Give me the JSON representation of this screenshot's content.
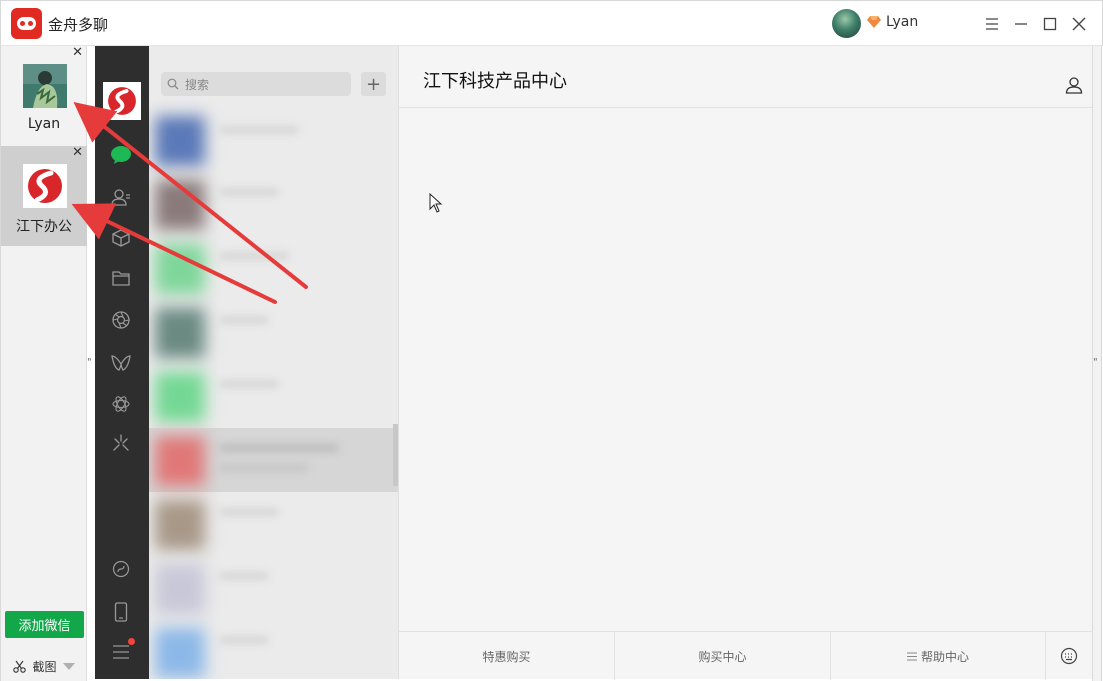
{
  "titlebar": {
    "app_title": "金舟多聊",
    "user_name": "Lyan"
  },
  "accounts": [
    {
      "label": "Lyan",
      "active": false
    },
    {
      "label": "江下办公",
      "active": true
    }
  ],
  "rail": {
    "add_wechat": "添加微信",
    "screenshot": "截图"
  },
  "wechat": {
    "search_placeholder": "搜索",
    "add_symbol": "+",
    "chat_title": "江下科技产品中心",
    "footer": [
      "特惠购买",
      "购买中心",
      "帮助中心"
    ]
  },
  "colors": {
    "brand_red": "#e02a22",
    "wechat_green": "#12a84a",
    "annotation_arrow": "#e53b3b"
  },
  "icons": {
    "nav": [
      "chat-icon",
      "contacts-icon",
      "cube-icon",
      "folder-icon",
      "moments-icon",
      "mini-program-icon",
      "atom-icon",
      "sparkle-icon",
      "link-icon",
      "phone-icon",
      "menu-icon"
    ]
  }
}
